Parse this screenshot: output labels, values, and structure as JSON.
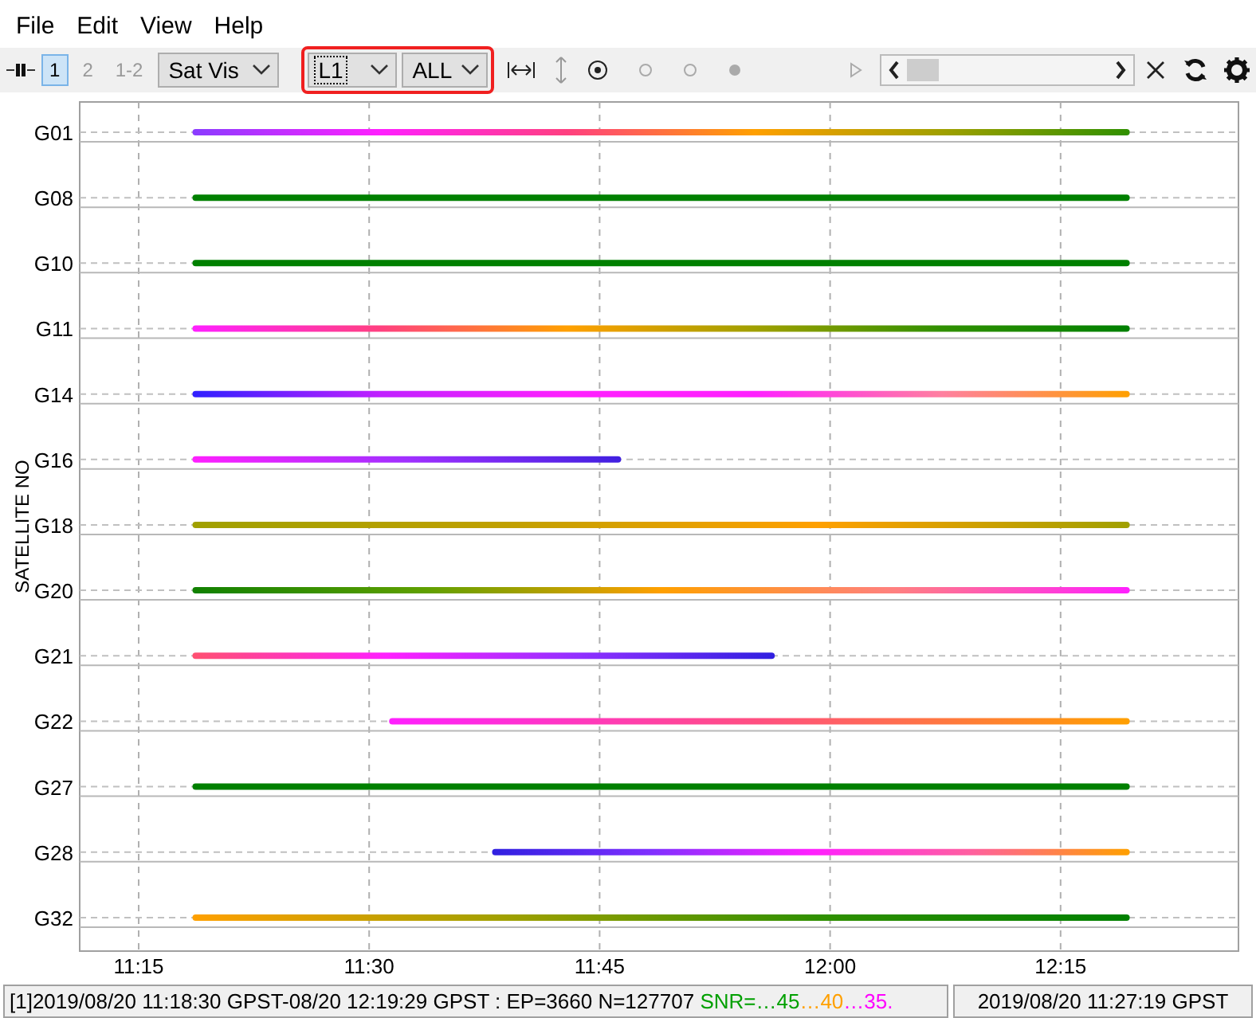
{
  "menu": [
    "File",
    "Edit",
    "View",
    "Help"
  ],
  "toolbar": {
    "frequency_buttons": [
      {
        "label": "1",
        "selected": true
      },
      {
        "label": "2",
        "selected": false
      },
      {
        "label": "1-2",
        "selected": false
      }
    ],
    "plot_type": "Sat Vis",
    "signal": "L1",
    "satellites": "ALL"
  },
  "plot": {
    "ylabel": "SATELLITE NO",
    "satellites": [
      "G01",
      "G08",
      "G10",
      "G11",
      "G14",
      "G16",
      "G18",
      "G20",
      "G21",
      "G22",
      "G27",
      "G28",
      "G32"
    ],
    "time_labels": [
      "11:15",
      "11:30",
      "11:45",
      "12:00",
      "12:15"
    ]
  },
  "status_bar": {
    "range": "[1]2019/08/20 11:18:30 GPST-08/20 12:19:29 GPST : EP=3660 N=127707 ",
    "snr_legend": [
      {
        "text": "SNR=…45",
        "color": "#00a000"
      },
      {
        "text": "…40",
        "color": "#ffa000"
      },
      {
        "text": "…35.",
        "color": "#ff00ff"
      }
    ],
    "time": "2019/08/20 11:27:19 GPST"
  }
}
